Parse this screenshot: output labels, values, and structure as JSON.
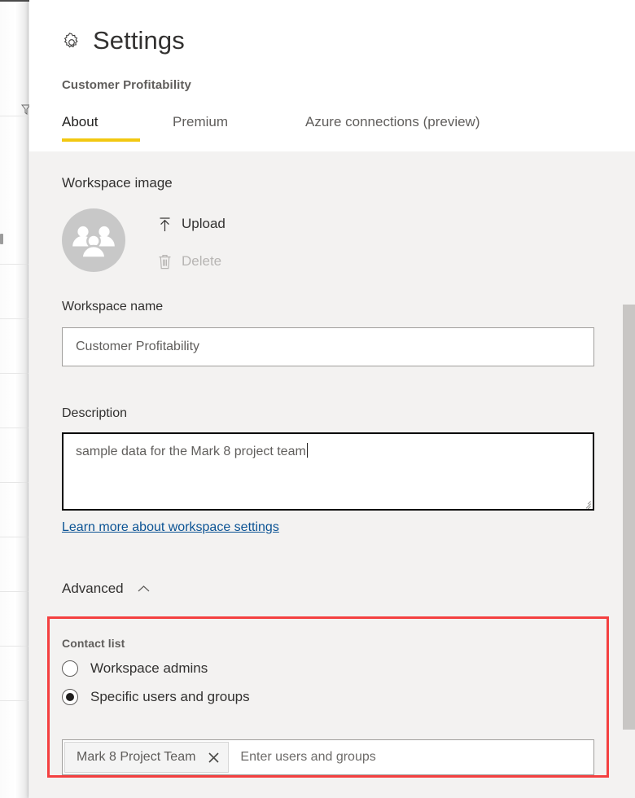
{
  "header": {
    "gear_icon": "gear-icon",
    "title": "Settings",
    "subtitle": "Customer Profitability"
  },
  "tabs": [
    {
      "label": "About",
      "active": true
    },
    {
      "label": "Premium",
      "active": false
    },
    {
      "label": "Azure connections (preview)",
      "active": false
    }
  ],
  "workspace_image": {
    "label": "Workspace image",
    "avatar_icon": "group-people-icon",
    "upload": {
      "label": "Upload",
      "icon": "upload-arrow-icon",
      "enabled": true
    },
    "delete": {
      "label": "Delete",
      "icon": "trash-icon",
      "enabled": false
    }
  },
  "workspace_name": {
    "label": "Workspace name",
    "value": "Customer Profitability",
    "placeholder": ""
  },
  "description": {
    "label": "Description",
    "value": "sample data for the Mark 8 project team",
    "focused": true
  },
  "learn_more": {
    "label": "Learn more about workspace settings"
  },
  "advanced": {
    "label": "Advanced",
    "chevron_icon": "chevron-up-icon",
    "expanded": true
  },
  "contact_list": {
    "label": "Contact list",
    "options": [
      {
        "label": "Workspace admins",
        "selected": false
      },
      {
        "label": "Specific users and groups",
        "selected": true
      }
    ],
    "tokens": [
      {
        "label": "Mark 8 Project Team",
        "remove_icon": "close-icon"
      }
    ],
    "input_placeholder": "Enter users and groups"
  },
  "colors": {
    "accent_yellow": "#f2c811",
    "annotation_red": "#f44040",
    "panel_background": "#f3f2f1",
    "link_blue": "#0b5394",
    "avatar_gray": "#c8c8c8"
  },
  "background": {
    "filter_icon": "filter-funnel-icon"
  }
}
